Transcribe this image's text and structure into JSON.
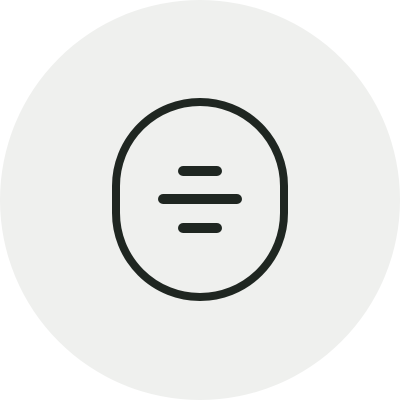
{
  "icon": {
    "name": "oval-with-horizontal-lines",
    "background_color": "#eff0ee",
    "stroke_color": "#1f2621"
  }
}
